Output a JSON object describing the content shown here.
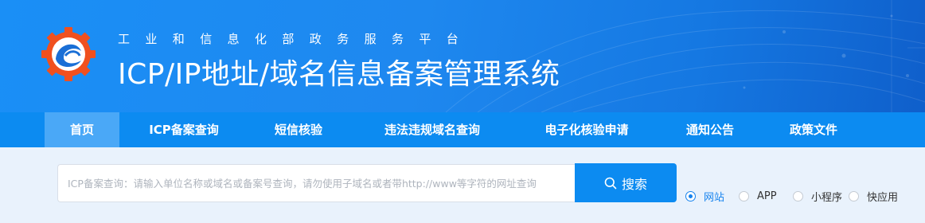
{
  "header": {
    "platform_name": "工业和信息化部政务服务平台",
    "system_title": "ICP/IP地址/域名信息备案管理系统"
  },
  "nav": {
    "items": [
      {
        "label": "首页",
        "active": true
      },
      {
        "label": "ICP备案查询",
        "active": false
      },
      {
        "label": "短信核验",
        "active": false
      },
      {
        "label": "违法违规域名查询",
        "active": false
      },
      {
        "label": "电子化核验申请",
        "active": false
      },
      {
        "label": "通知公告",
        "active": false
      },
      {
        "label": "政策文件",
        "active": false
      }
    ]
  },
  "search": {
    "placeholder": "ICP备案查询：请输入单位名称或域名或备案号查询，请勿使用子域名或者带http://www等字符的网址查询",
    "value": "",
    "button_label": "搜索",
    "button_icon": "search-icon"
  },
  "search_types": {
    "options": [
      {
        "label": "网站",
        "checked": true
      },
      {
        "label": "APP",
        "checked": false
      },
      {
        "label": "小程序",
        "checked": false
      },
      {
        "label": "快应用",
        "checked": false
      }
    ]
  },
  "colors": {
    "header_blue": "#1a8ff6",
    "nav_blue": "#0c8bf1",
    "nav_active": "#4aa8f7",
    "page_bg": "#e9f2fc",
    "radio_accent": "#1683ee",
    "logo_orange": "#f0501e"
  }
}
